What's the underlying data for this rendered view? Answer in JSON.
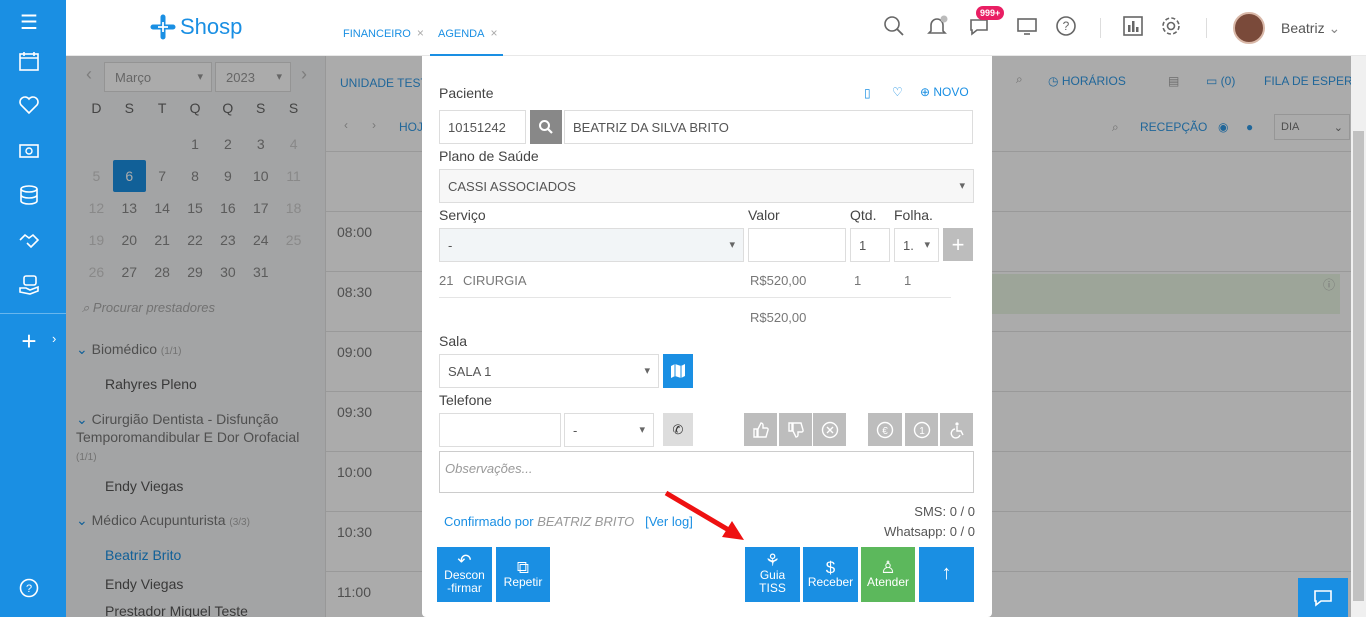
{
  "app": {
    "logo": "Shosp"
  },
  "tabs": [
    {
      "label": "FINANCEIRO",
      "close": "×"
    },
    {
      "label": "AGENDA",
      "close": "×"
    }
  ],
  "header": {
    "notif_badge": "999+",
    "user_name": "Beatriz"
  },
  "calendar": {
    "month": "Março",
    "year": "2023",
    "weekdays": [
      "D",
      "S",
      "T",
      "Q",
      "Q",
      "S",
      "S"
    ],
    "weeks": [
      [
        "",
        "",
        "",
        "1",
        "2",
        "3",
        "4"
      ],
      [
        "5",
        "6",
        "7",
        "8",
        "9",
        "10",
        "11"
      ],
      [
        "12",
        "13",
        "14",
        "15",
        "16",
        "17",
        "18"
      ],
      [
        "19",
        "20",
        "21",
        "22",
        "23",
        "24",
        "25"
      ],
      [
        "26",
        "27",
        "28",
        "29",
        "30",
        "31",
        ""
      ]
    ],
    "selected": "6"
  },
  "providers": {
    "search_placeholder": "Procurar prestadores",
    "groups": [
      {
        "name": "Biomédico",
        "count": "(1/1)"
      },
      {
        "name": "Cirurgião Dentista - Disfunção Temporomandibular E Dor Orofacial",
        "count": "(1/1)"
      },
      {
        "name": "Médico Acupunturista",
        "count": "(3/3)"
      }
    ],
    "items": [
      "Rahyres Pleno",
      "Endy Viegas",
      "Beatriz Brito",
      "Endy Viegas",
      "Prestador Miguel Teste"
    ]
  },
  "background": {
    "unidade": "UNIDADE TESTE",
    "hoje": "HOJE",
    "horarios": "HORÁRIOS",
    "fila_count": "(0)",
    "fila": "FILA DE ESPERA",
    "recepcao": "RECEPÇÃO",
    "view": "DIA",
    "hours": [
      "08:00",
      "08:30",
      "09:00",
      "09:30",
      "10:00",
      "10:30",
      "11:00"
    ]
  },
  "modal": {
    "paciente_label": "Paciente",
    "novo": "NOVO",
    "patient_id": "10151242",
    "patient_name": "BEATRIZ DA SILVA BRITO",
    "plano_label": "Plano de Saúde",
    "plano_value": "CASSI ASSOCIADOS",
    "servico_label": "Serviço",
    "valor_label": "Valor",
    "qtd_label": "Qtd.",
    "folha_label": "Folha.",
    "servico_value": "-",
    "qtd_value": "1",
    "folha_value": "1.",
    "service_row": {
      "code": "21",
      "name": "CIRURGIA",
      "valor": "R$520,00",
      "qtd": "1",
      "folha": "1"
    },
    "total": "R$520,00",
    "sala_label": "Sala",
    "sala_value": "SALA 1",
    "telefone_label": "Telefone",
    "telefone_ddd": "-",
    "obs_placeholder": "Observações...",
    "confirmado": "Confirmado por",
    "confirmado_by": "BEATRIZ BRITO",
    "ver_log": "[Ver log]",
    "sms": "SMS: 0 / 0",
    "whatsapp": "Whatsapp: 0 / 0",
    "actions": [
      {
        "label": "Descon-firmar"
      },
      {
        "label": "Repetir"
      },
      {
        "label": "Guia TISS"
      },
      {
        "label": "Receber"
      },
      {
        "label": "Atender"
      }
    ]
  },
  "colors": {
    "primary": "#1a8fe3",
    "green": "#5cb85c",
    "gray_btn": "#bdbdbd",
    "badge": "#e91e63",
    "arrow": "#ee1111"
  }
}
